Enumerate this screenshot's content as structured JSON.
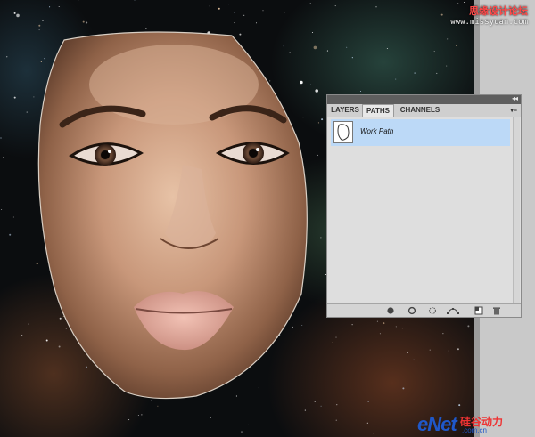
{
  "panel": {
    "tabs": [
      {
        "label": "LAYERS",
        "active": false
      },
      {
        "label": "PATHS",
        "active": true
      },
      {
        "label": "CHANNELS",
        "active": false
      }
    ],
    "collapse_icon": "double-chevron-icon",
    "menu_icon": "panel-menu-icon",
    "paths": [
      {
        "label": "Work Path",
        "selected": true
      }
    ],
    "footer_tools": [
      "fill-path-icon",
      "stroke-path-icon",
      "load-as-selection-icon",
      "make-work-path-icon",
      "new-path-icon",
      "delete-path-icon"
    ]
  },
  "watermark": {
    "top_line1": "思缘设计论坛",
    "top_line2": "www.missyuan.com",
    "bottom_logo_e": "e",
    "bottom_logo_net": "Net",
    "bottom_logo_cn": "硅谷动力",
    "bottom_logo_url": ".com.cn"
  },
  "colors": {
    "selection_highlight": "#bcd9f7",
    "panel_bg": "#dedede",
    "path_outline": "#d9cfc4"
  }
}
